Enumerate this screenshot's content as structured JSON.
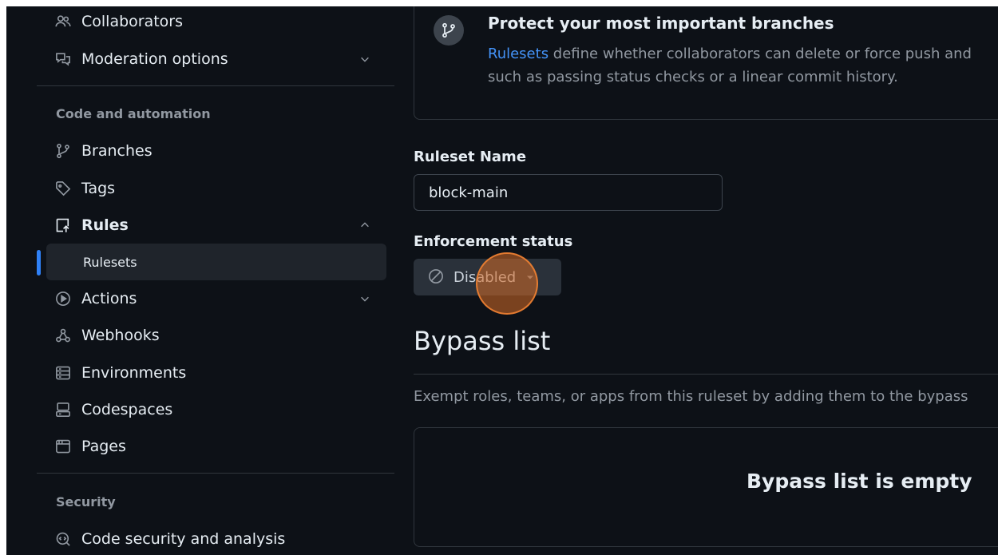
{
  "sidebar": {
    "items_top": [
      {
        "label": "Collaborators",
        "icon": "people-icon"
      },
      {
        "label": "Moderation options",
        "icon": "comment-discussion-icon"
      }
    ],
    "section_code": "Code and automation",
    "items_code": [
      {
        "label": "Branches",
        "icon": "git-branch-icon"
      },
      {
        "label": "Tags",
        "icon": "tag-icon"
      },
      {
        "label": "Rules",
        "icon": "rules-icon"
      },
      {
        "label": "Actions",
        "icon": "play-icon"
      },
      {
        "label": "Webhooks",
        "icon": "webhook-icon"
      },
      {
        "label": "Environments",
        "icon": "server-icon"
      },
      {
        "label": "Codespaces",
        "icon": "codespaces-icon"
      },
      {
        "label": "Pages",
        "icon": "browser-icon"
      }
    ],
    "rules_sub": "Rulesets",
    "section_security": "Security",
    "items_security": [
      {
        "label": "Code security and analysis",
        "icon": "codescan-icon"
      }
    ]
  },
  "main": {
    "protect_title": "Protect your most important branches",
    "protect_link": "Rulesets",
    "protect_desc_line1": " define whether collaborators can delete or force push and",
    "protect_desc_line2": "such as passing status checks or a linear commit history.",
    "ruleset_name_label": "Ruleset Name",
    "ruleset_name_value": "block-main",
    "enforcement_label": "Enforcement status",
    "enforcement_value": "Disabled",
    "bypass_title": "Bypass list",
    "bypass_desc": "Exempt roles, teams, or apps from this ruleset by adding them to the bypass",
    "bypass_empty": "Bypass list is empty"
  },
  "colors": {
    "background": "#0d1117",
    "border": "#30363d",
    "accent": "#2f81f7",
    "link": "#4493f8",
    "click_marker": "#d66c26"
  }
}
